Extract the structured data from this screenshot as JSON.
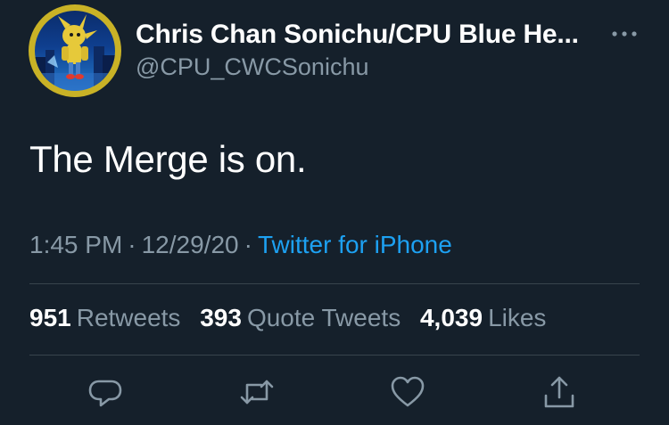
{
  "user": {
    "display_name": "Chris Chan Sonichu/CPU Blue He...",
    "handle": "@CPU_CWCSonichu",
    "avatar_icon": "profile-avatar"
  },
  "tweet": {
    "text": "The Merge is on."
  },
  "meta": {
    "time": "1:45 PM",
    "separator": "·",
    "date": "12/29/20",
    "source": "Twitter for iPhone"
  },
  "stats": {
    "retweets": {
      "count": "951",
      "label": "Retweets"
    },
    "quote_tweets": {
      "count": "393",
      "label": "Quote Tweets"
    },
    "likes": {
      "count": "4,039",
      "label": "Likes"
    }
  },
  "actions": [
    "reply-icon",
    "retweet-icon",
    "like-icon",
    "share-icon"
  ],
  "colors": {
    "background": "#15202b",
    "secondary_text": "#8899a6",
    "link": "#1da1f2",
    "divider": "#38444d",
    "avatar_ring": "#c9b226"
  }
}
